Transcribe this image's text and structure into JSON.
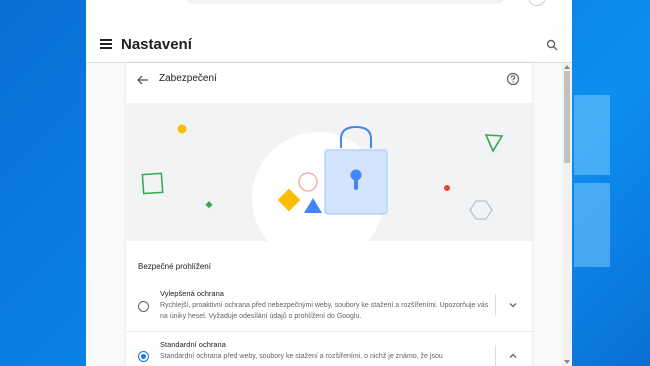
{
  "header": {
    "title": "Nastavení"
  },
  "page": {
    "title": "Zabezpečení"
  },
  "section": {
    "title": "Bezpečné prohlížení"
  },
  "options": [
    {
      "title": "Vylepšená ochrana",
      "description": "Rychlejší, proaktivní ochrana před nebezpečnými weby, soubory ke stažení a rozšířeními. Upozorňuje vás na úniky hesel. Vyžaduje odesílání údajů o prohlížení do Googlu.",
      "selected": false,
      "expanded": false
    },
    {
      "title": "Standardní ochrana",
      "description": "Standardní ochrana před weby, soubory ke stažení a rozšířeními, o nichž je známo, že jsou",
      "selected": true,
      "expanded": true
    }
  ],
  "colors": {
    "accent": "#1a73e8",
    "lock_fill": "#d2e3fc",
    "yellow": "#fbbc04",
    "green": "#34a853",
    "red": "#ea4335",
    "pink": "#f6aea9"
  },
  "icons": [
    "menu-icon",
    "search-icon",
    "back-arrow-icon",
    "help-icon",
    "chevron-down-icon",
    "chevron-up-icon",
    "lock-illustration"
  ]
}
